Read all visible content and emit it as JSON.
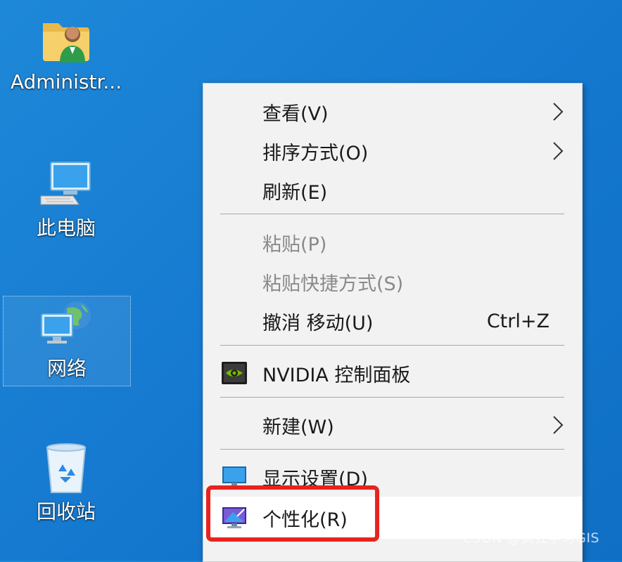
{
  "desktop": {
    "icons": [
      {
        "label": "Administr..."
      },
      {
        "label": "此电脑"
      },
      {
        "label": "网络"
      },
      {
        "label": "回收站"
      }
    ]
  },
  "context_menu": {
    "items": [
      {
        "label": "查看(V)",
        "submenu": true
      },
      {
        "label": "排序方式(O)",
        "submenu": true
      },
      {
        "label": "刷新(E)"
      },
      {
        "label": "粘贴(P)",
        "disabled": true
      },
      {
        "label": "粘贴快捷方式(S)",
        "disabled": true
      },
      {
        "label": "撤消 移动(U)",
        "shortcut": "Ctrl+Z"
      },
      {
        "label": "NVIDIA 控制面板",
        "icon": "nvidia-icon"
      },
      {
        "label": "新建(W)",
        "submenu": true
      },
      {
        "label": "显示设置(D)",
        "icon": "display-settings-icon"
      },
      {
        "label": "个性化(R)",
        "icon": "personalize-icon",
        "highlighted": true
      }
    ]
  },
  "watermark": "CSDN @疯狂学习GIS",
  "colors": {
    "desktop_bg": "#1478cf",
    "menu_bg": "#f2f2f2",
    "highlight": "#e8231e",
    "disabled_text": "#8a8a8a"
  }
}
